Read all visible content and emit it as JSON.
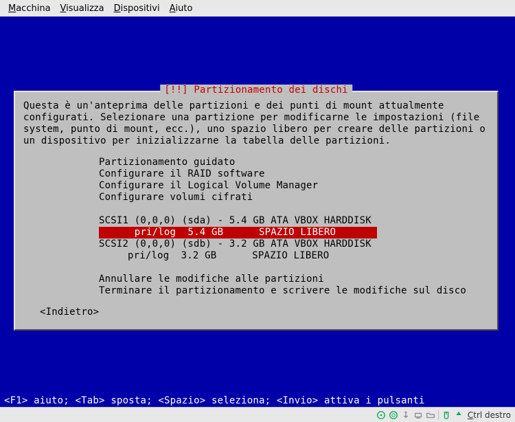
{
  "menubar": {
    "items": [
      {
        "label": "Macchina",
        "accel": "M"
      },
      {
        "label": "Visualizza",
        "accel": "V"
      },
      {
        "label": "Dispositivi",
        "accel": "D"
      },
      {
        "label": "Aiuto",
        "accel": "A"
      }
    ]
  },
  "dialog": {
    "title": "[!!] Partizionamento dei dischi",
    "description": "Questa è un'anteprima delle partizioni e dei punti di mount attualmente configurati. Selezionare una partizione per modificarne le impostazioni (file system, punto di mount, ecc.), uno spazio libero per creare delle partizioni o un dispositivo per inizializzarne la tabella delle partizioni.",
    "menu": {
      "guided": "Partizionamento guidato",
      "raid": "Configurare il RAID software",
      "lvm": "Configurare il Logical Volume Manager",
      "crypt": "Configurare volumi cifrati",
      "disks": [
        {
          "header": "SCSI1 (0,0,0) (sda) - 5.4 GB ATA VBOX HARDDISK",
          "device": "sda",
          "bus": "SCSI1 (0,0,0)",
          "size": "5.4 GB",
          "model": "ATA VBOX HARDDISK",
          "partitions": [
            {
              "line": "pri/log  5.4 GB      SPAZIO LIBERO",
              "type": "pri/log",
              "size": "5.4 GB",
              "state": "SPAZIO LIBERO",
              "selected": true
            }
          ]
        },
        {
          "header": "SCSI2 (0,0,0) (sdb) - 3.2 GB ATA VBOX HARDDISK",
          "device": "sdb",
          "bus": "SCSI2 (0,0,0)",
          "size": "3.2 GB",
          "model": "ATA VBOX HARDDISK",
          "partitions": [
            {
              "line": "pri/log  3.2 GB      SPAZIO LIBERO",
              "type": "pri/log",
              "size": "3.2 GB",
              "state": "SPAZIO LIBERO",
              "selected": false
            }
          ]
        }
      ],
      "undo": "Annullare le modifiche alle partizioni",
      "finish": "Terminare il partizionamento e scrivere le modifiche sul disco"
    },
    "back": "<Indietro>"
  },
  "hintbar": "<F1> aiuto; <Tab> sposta; <Spazio> seleziona; <Invio> attiva i pulsanti",
  "statusbar": {
    "hostkey": "Ctrl destro",
    "hostkey_accel": "C"
  }
}
